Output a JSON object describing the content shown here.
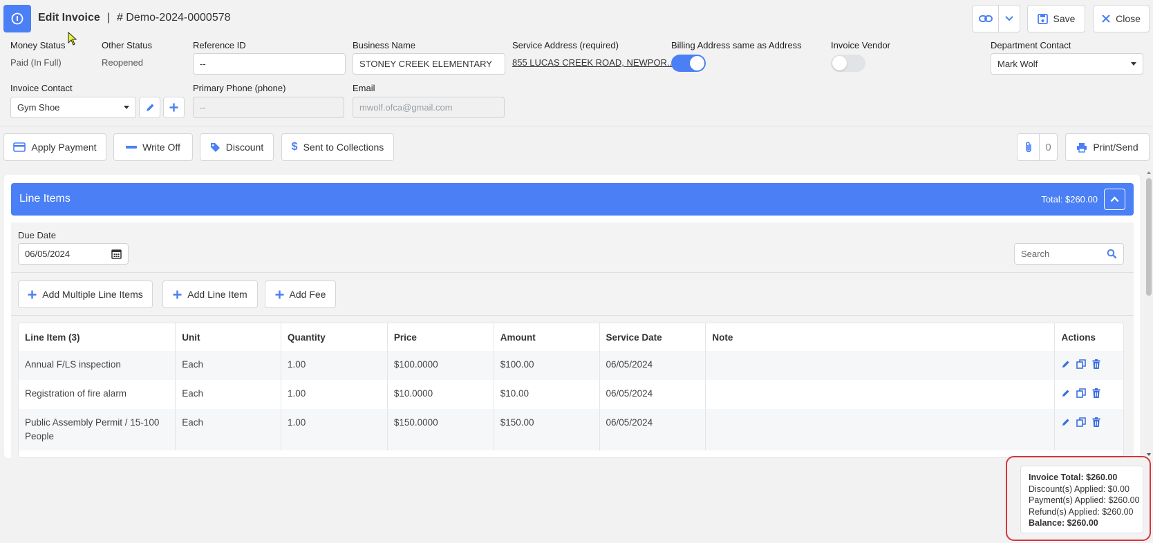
{
  "header": {
    "title": "Edit Invoice",
    "separator": "|",
    "invoice_number": "# Demo-2024-0000578",
    "save_label": "Save",
    "close_label": "Close"
  },
  "fields": {
    "money_status": {
      "label": "Money Status",
      "value": "Paid (In Full)"
    },
    "other_status": {
      "label": "Other Status",
      "value": "Reopened"
    },
    "reference_id": {
      "label": "Reference ID",
      "value": "--"
    },
    "business_name": {
      "label": "Business Name",
      "value": "STONEY CREEK ELEMENTARY"
    },
    "service_address": {
      "label": "Service Address (required)",
      "value": "855 LUCAS CREEK ROAD, NEWPOR..."
    },
    "billing_same": {
      "label": "Billing Address same as Address",
      "on": true
    },
    "invoice_vendor": {
      "label": "Invoice Vendor",
      "on": false
    },
    "department_contact": {
      "label": "Department Contact",
      "value": "Mark Wolf"
    },
    "invoice_contact": {
      "label": "Invoice Contact",
      "value": "Gym Shoe"
    },
    "primary_phone": {
      "label": "Primary Phone (phone)",
      "value": "--"
    },
    "email": {
      "label": "Email",
      "value": "mwolf.ofca@gmail.com"
    }
  },
  "toolbar": {
    "apply_payment": "Apply Payment",
    "write_off": "Write Off",
    "discount": "Discount",
    "sent_to_collections": "Sent to Collections",
    "attachments_count": "0",
    "print_send": "Print/Send"
  },
  "line_items": {
    "title": "Line Items",
    "total": "Total: $260.00",
    "due_date_label": "Due Date",
    "due_date": "06/05/2024",
    "search_placeholder": "Search",
    "add_multiple": "Add Multiple Line Items",
    "add_line_item": "Add Line Item",
    "add_fee": "Add Fee",
    "columns": [
      "Line Item (3)",
      "Unit",
      "Quantity",
      "Price",
      "Amount",
      "Service Date",
      "Note",
      "Actions"
    ],
    "rows": [
      {
        "item": "Annual F/LS inspection",
        "unit": "Each",
        "quantity": "1.00",
        "price": "$100.0000",
        "amount": "$100.00",
        "service_date": "06/05/2024",
        "note": ""
      },
      {
        "item": "Registration of fire alarm",
        "unit": "Each",
        "quantity": "1.00",
        "price": "$10.0000",
        "amount": "$10.00",
        "service_date": "06/05/2024",
        "note": ""
      },
      {
        "item": "Public Assembly Permit / 15-100 People",
        "unit": "Each",
        "quantity": "1.00",
        "price": "$150.0000",
        "amount": "$150.00",
        "service_date": "06/05/2024",
        "note": ""
      }
    ]
  },
  "summary": {
    "invoice_total": "Invoice Total: $260.00",
    "discounts": "Discount(s) Applied: $0.00",
    "payments": "Payment(s) Applied: $260.00",
    "refunds": "Refund(s) Applied: $260.00",
    "balance": "Balance: $260.00"
  },
  "colors": {
    "accent": "#4a7ff5",
    "highlight_ring": "#d9343b"
  }
}
